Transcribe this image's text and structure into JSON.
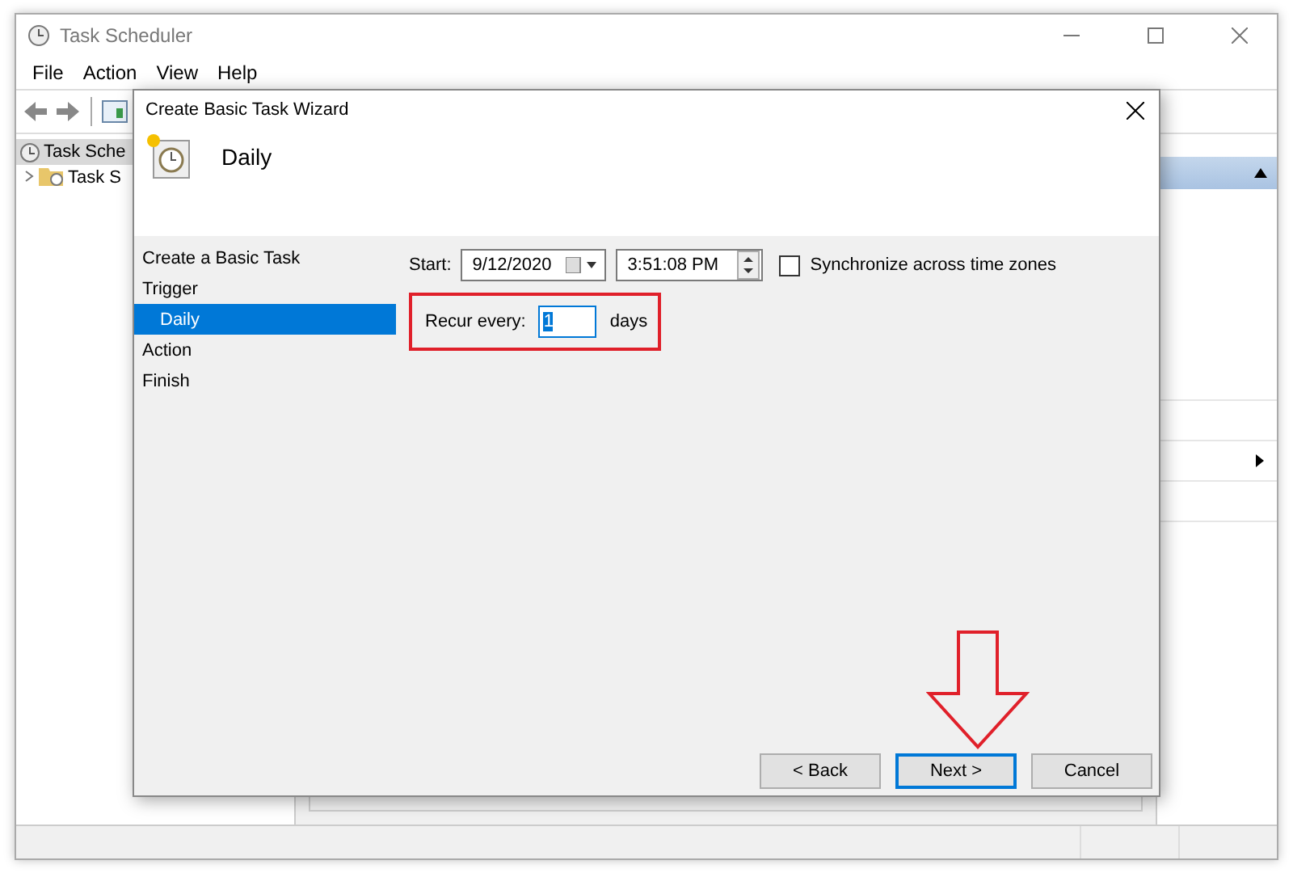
{
  "window": {
    "title": "Task Scheduler"
  },
  "menu": [
    {
      "label": "File"
    },
    {
      "label": "Action"
    },
    {
      "label": "View"
    },
    {
      "label": "Help"
    }
  ],
  "tree": [
    {
      "label": "Task Sche",
      "selected": true,
      "children": [
        {
          "label": "Task S",
          "expanded": false
        }
      ]
    }
  ],
  "dialog": {
    "title": "Create Basic Task Wizard",
    "heading": "Daily",
    "steps": [
      {
        "label": "Create a Basic Task",
        "selected": false
      },
      {
        "label": "Trigger",
        "selected": false,
        "children": [
          {
            "label": "Daily",
            "selected": true
          }
        ]
      },
      {
        "label": "Action",
        "selected": false
      },
      {
        "label": "Finish",
        "selected": false
      }
    ],
    "start": {
      "label": "Start:",
      "date": "9/12/2020",
      "time": "3:51:08 PM"
    },
    "sync": {
      "label": "Synchronize across time zones",
      "checked": false
    },
    "recur": {
      "label": "Recur every:",
      "value": "1",
      "unit": "days",
      "highlighted": true
    },
    "buttons": [
      {
        "label": "< Back",
        "default": false
      },
      {
        "label": "Next >",
        "default": true
      },
      {
        "label": "Cancel",
        "default": false
      }
    ],
    "annotations": [
      {
        "kind": "down-arrow"
      }
    ]
  }
}
